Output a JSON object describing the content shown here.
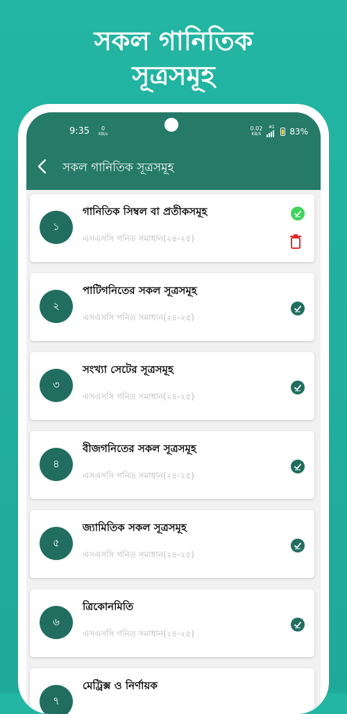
{
  "promo": {
    "title_line1": "সকল গানিতিক",
    "title_line2": "সূত্রসমূহ"
  },
  "status_bar": {
    "time": "9:35",
    "left_speed": "0",
    "left_speed_unit": "KB/s",
    "right_speed": "0.02",
    "right_speed_unit": "KB/S",
    "network": "4G",
    "battery": "83%"
  },
  "app_bar": {
    "title": "সকল গানিতিক সূত্রসমূহ",
    "back_icon": "chevron-left-icon"
  },
  "colors": {
    "accent": "#267a68",
    "badge": "#216e60",
    "check_done": "#3fd45d",
    "delete": "#e02c2c"
  },
  "list": [
    {
      "number": "১",
      "title": "গানিতিক সিম্বল বা প্রতীকসমূহ",
      "subtitle": "এসএসসি গনিত সমাধান(২৪-২৫)"
    },
    {
      "number": "২",
      "title": "পাটিগনিতের সকল সূত্রসমূহ",
      "subtitle": "এসএসসি গনিত সমাধান(২৪-২৫)"
    },
    {
      "number": "৩",
      "title": "সংখ্যা সেটের সূত্রসমূহ",
      "subtitle": "এসএসসি গনিত সমাধান(২৪-২৫)"
    },
    {
      "number": "৪",
      "title": "বীজগনিতের সকল সূত্রসমূহ",
      "subtitle": "এসএসসি গনিত সমাধান(২৪-২৫)"
    },
    {
      "number": "৫",
      "title": "জ্যামিতিক সকল সূত্রসমূহ",
      "subtitle": "এসএসসি গনিত সমাধান(২৪-২৫)"
    },
    {
      "number": "৬",
      "title": "ত্রিকোনমিতি",
      "subtitle": "এসএসসি গনিত সমাধান(২৪-২৫)"
    },
    {
      "number": "৭",
      "title": "মেট্রিক্স ও নির্ণায়ক",
      "subtitle": ""
    }
  ]
}
